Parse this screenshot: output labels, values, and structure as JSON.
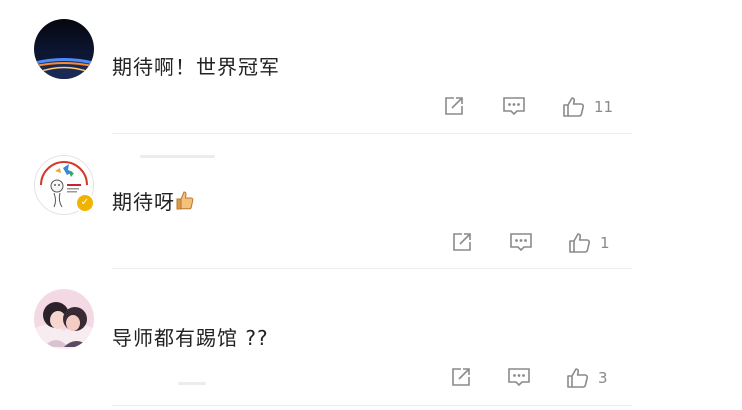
{
  "comments": [
    {
      "text": "期待啊！世界冠军",
      "likes": "11",
      "avatar": "earth-horizon-avatar",
      "verified": false
    },
    {
      "text": "期待呀",
      "likes": "1",
      "avatar": "cartoon-logo-avatar",
      "verified": true,
      "trailing_emoji": "thumbs-up-icon"
    },
    {
      "text": "导师都有踢馆 ??",
      "likes": "3",
      "avatar": "illustrated-couple-avatar",
      "verified": false
    }
  ],
  "colors": {
    "icon_gray": "#8a8a8a",
    "text": "#222222",
    "divider": "#ececec",
    "badge": "#f0b400"
  },
  "icons": [
    "share-icon",
    "comment-icon",
    "like-icon"
  ]
}
